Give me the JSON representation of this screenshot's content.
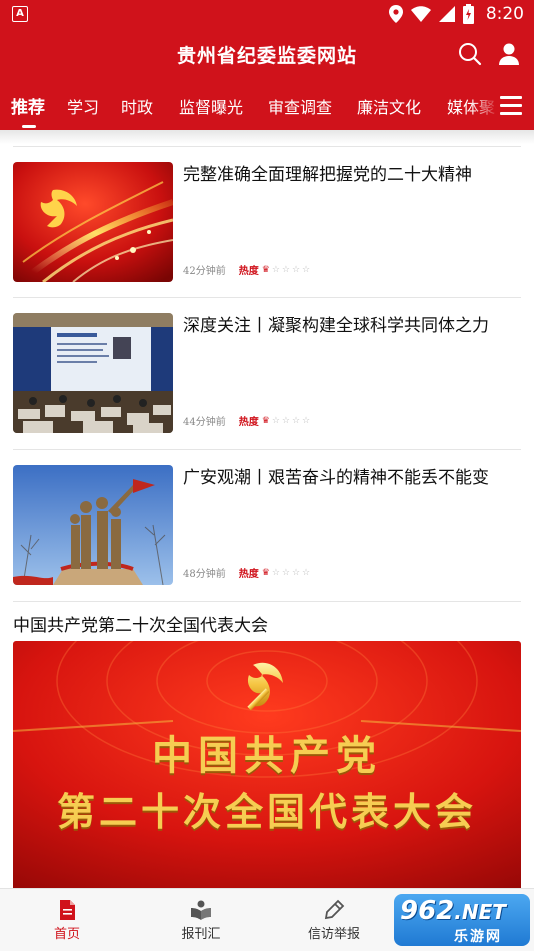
{
  "status_bar": {
    "time": "8:20",
    "left_icon": "A",
    "icons": [
      "location-icon",
      "wifi-icon",
      "signal-icon",
      "battery-charging-icon"
    ]
  },
  "header": {
    "title": "贵州省纪委监委网站",
    "search_icon": "search-icon",
    "user_icon": "user-icon"
  },
  "tabs": [
    {
      "label": "推荐",
      "active": true
    },
    {
      "label": "学习"
    },
    {
      "label": "时政"
    },
    {
      "label": "监督曝光"
    },
    {
      "label": "审查调查"
    },
    {
      "label": "廉洁文化"
    },
    {
      "label": "媒体聚"
    }
  ],
  "articles": [
    {
      "title": "完整准确全面理解把握党的二十大精神",
      "time": "42分钟前",
      "hot_label": "热度"
    },
    {
      "title": "深度关注丨凝聚构建全球科学共同体之力",
      "time": "44分钟前",
      "hot_label": "热度"
    },
    {
      "title": "广安观潮丨艰苦奋斗的精神不能丢不能变",
      "time": "48分钟前",
      "hot_label": "热度"
    }
  ],
  "section": {
    "title": "中国共产党第二十次全国代表大会",
    "banner_line1": "中国共产党",
    "banner_line2": "第二十次全国代表大会"
  },
  "bottom_nav": [
    {
      "label": "首页",
      "icon": "home-document-icon",
      "active": true
    },
    {
      "label": "报刊汇",
      "icon": "book-icon"
    },
    {
      "label": "信访举报",
      "icon": "pen-icon"
    }
  ],
  "watermark": {
    "brand": "962",
    "suffix": ".NET",
    "subtitle": "乐游网"
  },
  "colors": {
    "brand_red": "#d0121b",
    "gold": "#f5c542"
  }
}
